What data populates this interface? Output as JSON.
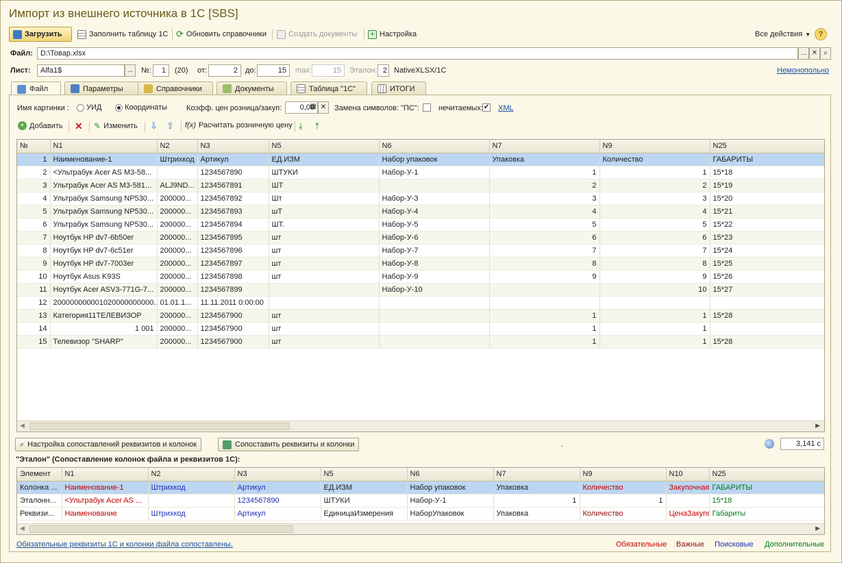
{
  "window": {
    "title": "Импорт из внешнего источника в 1С [SBS]"
  },
  "toolbar": {
    "load": "Загрузить",
    "fill": "Заполнить таблицу 1С",
    "refresh": "Обновить справочники",
    "create": "Создать документы",
    "settings": "Настройка",
    "all_actions": "Все действия",
    "help": "?"
  },
  "file": {
    "label": "Файл:",
    "value": "D:\\Товар.xlsx",
    "dots": "...",
    "clear": "✕",
    "search": "⌕"
  },
  "sheet": {
    "label": "Лист:",
    "value": "Alfa1$",
    "dots": "...",
    "num_label": "№:",
    "num": "1",
    "count": "(20)",
    "from_label": "от:",
    "from": "2",
    "to_label": "до:",
    "to": "15",
    "max_label": "max:",
    "max": "15",
    "etalon_label": "Эталон:",
    "etalon": "2",
    "mode": "NativeXLSX/1C",
    "link": "Немонопольно"
  },
  "tabs": [
    "Файл",
    "Параметры",
    "Справочники",
    "Документы",
    "Таблица \"1С\"",
    "ИТОГИ"
  ],
  "options": {
    "image_name_label": "Имя картинки :",
    "uid": "УИД",
    "coords": "Координаты",
    "coef_label": "Коэфф. цен розница/закуп:",
    "coef": "0,00",
    "replace_label": "Замена символов: \"ПС\":",
    "nonprint_label": "нечитаемых:",
    "xml": "XML"
  },
  "actions": {
    "add": "Добавить",
    "edit": "Изменить",
    "calc": "Расчитать розничную цену"
  },
  "main_table": {
    "headers": [
      "№",
      "N1",
      "N2",
      "N3",
      "N5",
      "N6",
      "N7",
      "N9",
      "N25"
    ],
    "rows": [
      [
        "1",
        "Наименование-1",
        "Штрихкод",
        "Артикул",
        "ЕД.ИЗМ",
        "Набор упаковок",
        "Упаковка",
        "Количество",
        "ГАБАРИТЫ"
      ],
      [
        "2",
        "<Ультрабук Acer AS M3-58...",
        "",
        "1234567890",
        "ШТУКИ",
        "Набор-У-1",
        "1",
        "1",
        "15*18"
      ],
      [
        "3",
        "Ультрабук Acer AS M3-581...",
        "ALJ9ND...",
        "1234567891",
        "ШТ",
        "",
        "2",
        "2",
        "15*19"
      ],
      [
        "4",
        "Ультрабук Samsung NP530...",
        "200000...",
        "1234567892",
        "Шт",
        "Набор-У-3",
        "3",
        "3",
        "15*20"
      ],
      [
        "5",
        "Ультрабук Samsung NP530...",
        "200000...",
        "1234567893",
        "шТ",
        "Набор-У-4",
        "4",
        "4",
        "15*21"
      ],
      [
        "6",
        "Ультрабук Samsung NP530...",
        "200000...",
        "1234567894",
        "ШТ.",
        "Набор-У-5",
        "5",
        "5",
        "15*22"
      ],
      [
        "7",
        "Ноутбук HP dv7-6b50er",
        "200000...",
        "1234567895",
        "шт",
        "Набор-У-6",
        "6",
        "6",
        "15*23"
      ],
      [
        "8",
        "Ноутбук HP dv7-6c51er",
        "200000...",
        "1234567896",
        "шт",
        "Набор-У-7",
        "7",
        "7",
        "15*24"
      ],
      [
        "9",
        "Ноутбук HP dv7-7003er",
        "200000...",
        "1234567897",
        "шт",
        "Набор-У-8",
        "8",
        "8",
        "15*25"
      ],
      [
        "10",
        "Ноутбук Asus K93S",
        "200000...",
        "1234567898",
        "шт",
        "Набор-У-9",
        "9",
        "9",
        "15*26"
      ],
      [
        "11",
        "Ноутбук Acer ASV3-771G-7...",
        "200000...",
        "1234567899",
        "",
        "Набор-У-10",
        "",
        "10",
        "15*27"
      ],
      [
        "12",
        "200000000001020000000000...",
        "01.01.1...",
        "11.11.2011 0:00:00",
        "",
        "",
        "",
        "",
        ""
      ],
      [
        "13",
        "Категория11ТЕЛЕВИЗОР",
        "200000...",
        "1234567900",
        "шт",
        "",
        "1",
        "1",
        "15*28"
      ],
      [
        "14",
        "1 001",
        "200000...",
        "1234567900",
        "шт",
        "",
        "1",
        "1",
        ""
      ],
      [
        "15",
        "Телевизор \"SHARP\"",
        "200000...",
        "1234567900",
        "шт",
        "",
        "1",
        "1",
        "15*28"
      ]
    ]
  },
  "mapping": {
    "settings_btn": "Настройка сопоставлений реквизитов и колонок",
    "match_btn": "Сопоставить реквизиты и колонки",
    "dot": ".",
    "time": "3,141 с",
    "title": "\"Эталон\" (Сопоставление колонок файла и реквизитов 1С):"
  },
  "etalon_table": {
    "headers": [
      "Элемент",
      "N1",
      "N2",
      "N3",
      "N5",
      "N6",
      "N7",
      "N9",
      "N10",
      "N25"
    ],
    "rows": [
      [
        "Колонка ...",
        "Наименование-1",
        "Штрихкод",
        "Артикул",
        "ЕД.ИЗМ",
        "Набор упаковок",
        "Упаковка",
        "Количество",
        "Закупочная",
        "ГАБАРИТЫ"
      ],
      [
        "Эталонн...",
        "<Ультрабук Acer AS ...",
        "",
        "1234567890",
        "ШТУКИ",
        "Набор-У-1",
        "1",
        "1",
        "",
        "15*18"
      ],
      [
        "Реквизи...",
        "Наименование",
        "Штрихкод",
        "Артикул",
        "ЕдиницаИзмерения",
        "НаборУпаковок",
        "Упаковка",
        "Количество",
        "ЦенаЗакупо",
        "Габариты"
      ]
    ]
  },
  "status": {
    "left": "Обязательные реквизиты 1С и колонки файла сопоставлены.",
    "legend": [
      "Обязательные",
      "Важные",
      "Поисковые",
      "Дополнительные"
    ]
  }
}
